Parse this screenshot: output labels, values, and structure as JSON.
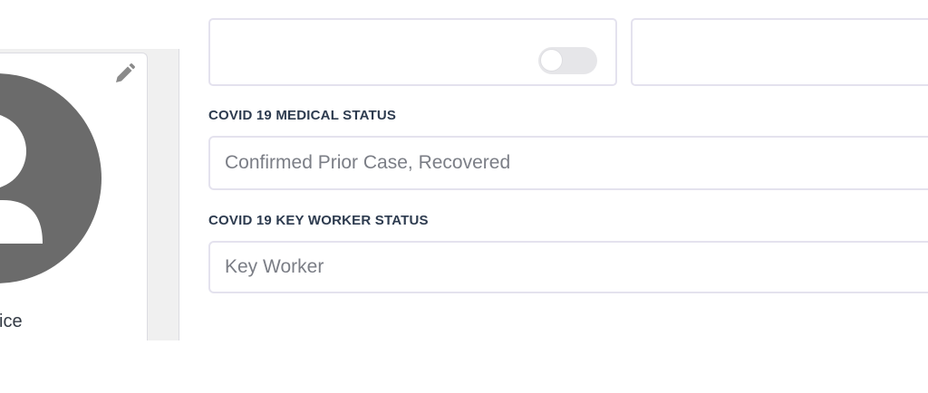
{
  "profile": {
    "name_fragment": "ice",
    "avatar_icon": "user-avatar-icon",
    "edit_icon": "pencil-icon"
  },
  "form": {
    "toggle": {
      "state": "off"
    },
    "covid_medical": {
      "label": "COVID 19 MEDICAL STATUS",
      "value": "Confirmed Prior Case, Recovered"
    },
    "covid_keyworker": {
      "label": "COVID 19 KEY WORKER STATUS",
      "value": "Key Worker"
    }
  },
  "colors": {
    "label_text": "#2d3b4f",
    "input_border": "#e4e2ee",
    "input_text": "#7b7e86",
    "avatar_gray": "#6b6b6b"
  }
}
